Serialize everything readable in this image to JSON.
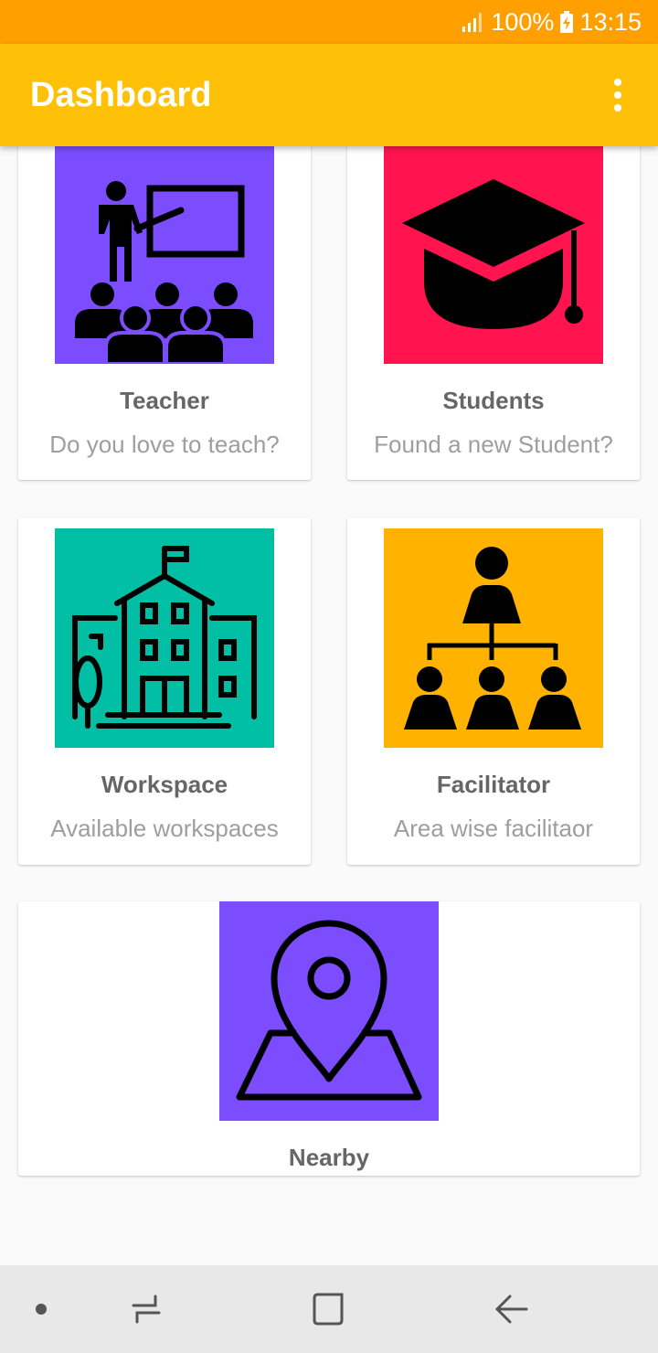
{
  "status_bar": {
    "battery": "100%",
    "time": "13:15"
  },
  "app_bar": {
    "title": "Dashboard",
    "menu_icon": "more-vert-icon"
  },
  "cards": [
    {
      "title": "Teacher",
      "subtitle": "Do you love to teach?",
      "icon": "teacher-classroom-icon",
      "color": "#7c4dff"
    },
    {
      "title": "Students",
      "subtitle": "Found a new Student?",
      "icon": "graduation-cap-icon",
      "color": "#ff1450"
    },
    {
      "title": "Workspace",
      "subtitle": "Available workspaces",
      "icon": "school-building-icon",
      "color": "#00bfa5"
    },
    {
      "title": "Facilitator",
      "subtitle": "Area wise facilitaor",
      "icon": "hierarchy-icon",
      "color": "#ffb300"
    },
    {
      "title": "Nearby",
      "icon": "map-pin-icon",
      "color": "#7c4dff"
    }
  ],
  "nav_bar": {
    "items": [
      "dot-icon",
      "recents-icon",
      "home-icon",
      "back-icon"
    ]
  }
}
